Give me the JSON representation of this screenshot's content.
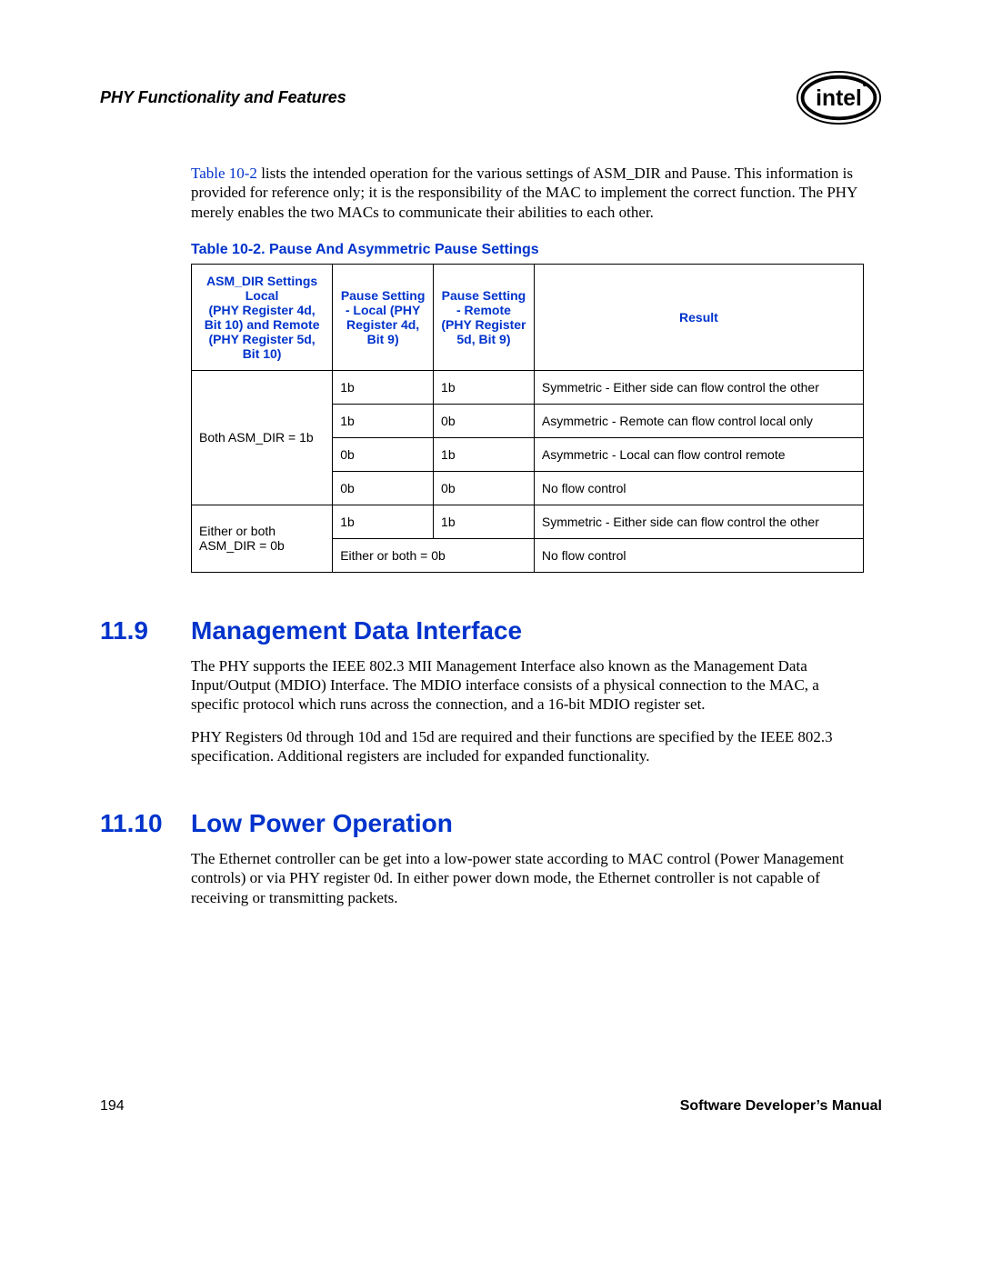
{
  "header": {
    "chapter_title": "PHY Functionality and Features",
    "logo_alt": "intel"
  },
  "intro_ref": "Table 10-2",
  "intro_text": " lists the intended operation for the various settings of ASM_DIR and Pause. This information is provided for reference only; it is the responsibility of the MAC to implement the correct function. The PHY merely enables the two MACs to communicate their abilities to each other.",
  "table": {
    "caption": "Table 10-2. Pause And Asymmetric Pause Settings",
    "headers": {
      "c0": "ASM_DIR Settings Local\n(PHY Register 4d, Bit 10) and Remote (PHY Register 5d, Bit 10)",
      "c1": "Pause Setting - Local (PHY Register 4d, Bit 9)",
      "c2": "Pause Setting - Remote (PHY Register 5d, Bit 9)",
      "c3": "Result"
    },
    "group1_label": "Both ASM_DIR = 1b",
    "g1": [
      {
        "local": "1b",
        "remote": "1b",
        "result": "Symmetric - Either side can flow control the other"
      },
      {
        "local": "1b",
        "remote": "0b",
        "result": "Asymmetric - Remote can flow control local only"
      },
      {
        "local": "0b",
        "remote": "1b",
        "result": "Asymmetric - Local can flow control remote"
      },
      {
        "local": "0b",
        "remote": "0b",
        "result": "No flow control"
      }
    ],
    "group2_label": "Either or both ASM_DIR = 0b",
    "g2r1": {
      "local": "1b",
      "remote": "1b",
      "result": "Symmetric - Either side can flow control the other"
    },
    "g2r2": {
      "merged": "Either or both = 0b",
      "result": "No flow control"
    }
  },
  "sections": {
    "s119": {
      "num": "11.9",
      "title": "Management Data Interface",
      "p1": "The PHY supports the IEEE 802.3 MII Management Interface also known as the Management Data Input/Output (MDIO) Interface. The MDIO interface consists of a physical connection to the MAC, a specific protocol which runs across the connection, and a 16-bit MDIO register set.",
      "p2": "PHY Registers 0d through 10d and 15d are required and their functions are specified by the IEEE 802.3 specification. Additional registers are included for expanded functionality."
    },
    "s1110": {
      "num": "11.10",
      "title": "Low Power Operation",
      "p1": "The Ethernet controller can be get into a low-power state according to MAC control (Power Management controls) or via PHY register 0d. In either power down mode, the Ethernet controller is not capable of receiving or transmitting packets."
    }
  },
  "footer": {
    "page_num": "194",
    "manual_title": "Software Developer’s Manual"
  }
}
